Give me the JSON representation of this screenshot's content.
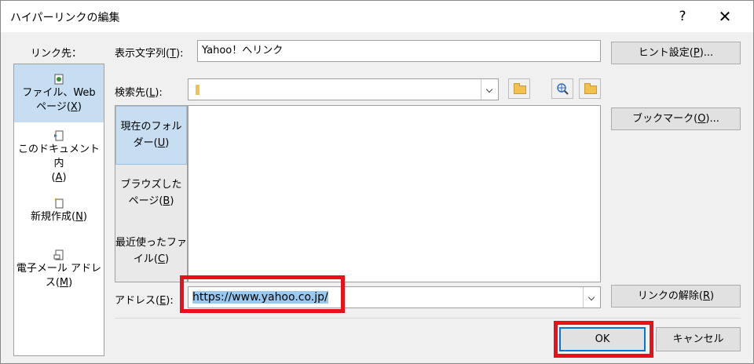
{
  "dialog": {
    "title": "ハイパーリンクの編集",
    "help": "?",
    "close": "✕"
  },
  "link_to": {
    "label": "リンク先：",
    "items": [
      {
        "line1": "ファイル、Web",
        "line2": "ページ(",
        "key": "X",
        "tail": ")"
      },
      {
        "line1": "このドキュメント内",
        "line2": "(",
        "key": "A",
        "tail": ")"
      },
      {
        "line1": "新規作成(",
        "key": "N",
        "tail": ")"
      },
      {
        "line1": "電子メール アドレ",
        "line2": "ス(",
        "key": "M",
        "tail": ")"
      }
    ]
  },
  "display_text": {
    "label_pre": "表示文字列(",
    "label_key": "T",
    "label_post": "):",
    "value": "Yahoo！へリンク"
  },
  "screentip_button": {
    "pre": "ヒント設定(",
    "key": "P",
    "post": ")..."
  },
  "look_in": {
    "label_pre": "検索先(",
    "label_key": "L",
    "label_post": "):"
  },
  "bookmark_button": {
    "pre": "ブックマーク(",
    "key": "O",
    "post": ")..."
  },
  "look_list": [
    {
      "line1": "現在のフォル",
      "line2": "ダー(",
      "key": "U",
      "tail": ")"
    },
    {
      "line1": "ブラウズした",
      "line2": "ページ(",
      "key": "B",
      "tail": ")"
    },
    {
      "line1": "最近使ったファ",
      "line2": "イル(",
      "key": "C",
      "tail": ")"
    }
  ],
  "address": {
    "label_pre": "アドレス(",
    "label_key": "E",
    "label_post": "):",
    "value": "https://www.yahoo.co.jp/"
  },
  "remove_link_button": {
    "pre": "リンクの解除(",
    "key": "R",
    "post": ")"
  },
  "ok_button": "OK",
  "cancel_button": "キャンセル",
  "colors": {
    "highlight": "#e8111a",
    "selection": "#c6ddf2",
    "text_selection": "#99c9ef"
  }
}
